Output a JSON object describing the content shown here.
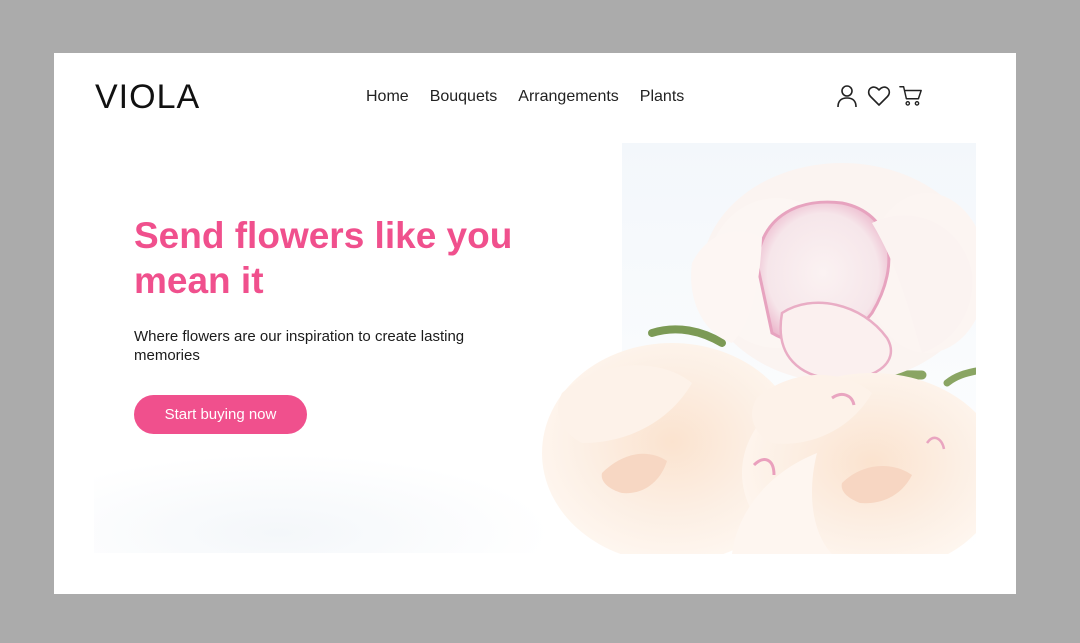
{
  "brand": {
    "logo_text": "VIOLA"
  },
  "nav": {
    "items": [
      "Home",
      "Bouquets",
      "Arrangements",
      "Plants"
    ]
  },
  "header_icons": [
    "user-icon",
    "heart-icon",
    "cart-icon"
  ],
  "hero": {
    "headline": "Send flowers like you mean it",
    "subtext": "Where flowers are our inspiration to create lasting memories",
    "cta_label": "Start buying now",
    "image_subject": "peony-flowers"
  },
  "colors": {
    "accent": "#f0508d",
    "page_bg": "#ababab",
    "card_bg": "#ffffff",
    "text": "#1b1b1b"
  }
}
